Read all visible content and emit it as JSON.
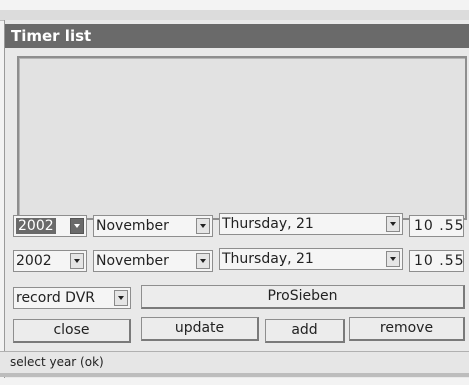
{
  "window": {
    "title": "Timer list"
  },
  "row1": {
    "year": "2002",
    "month": "November",
    "day": "Thursday, 21",
    "time": "10 .55"
  },
  "row2": {
    "year": "2002",
    "month": "November",
    "day": "Thursday, 21",
    "time": "10 .55"
  },
  "row3": {
    "type": "record DVR",
    "channel": "ProSieben"
  },
  "buttons": {
    "close": "close",
    "update": "update",
    "add": "add",
    "remove": "remove"
  },
  "status": "select year (ok)",
  "colors": {
    "titlebar": "#6a6a6a",
    "selected": "#6a6a6a"
  }
}
